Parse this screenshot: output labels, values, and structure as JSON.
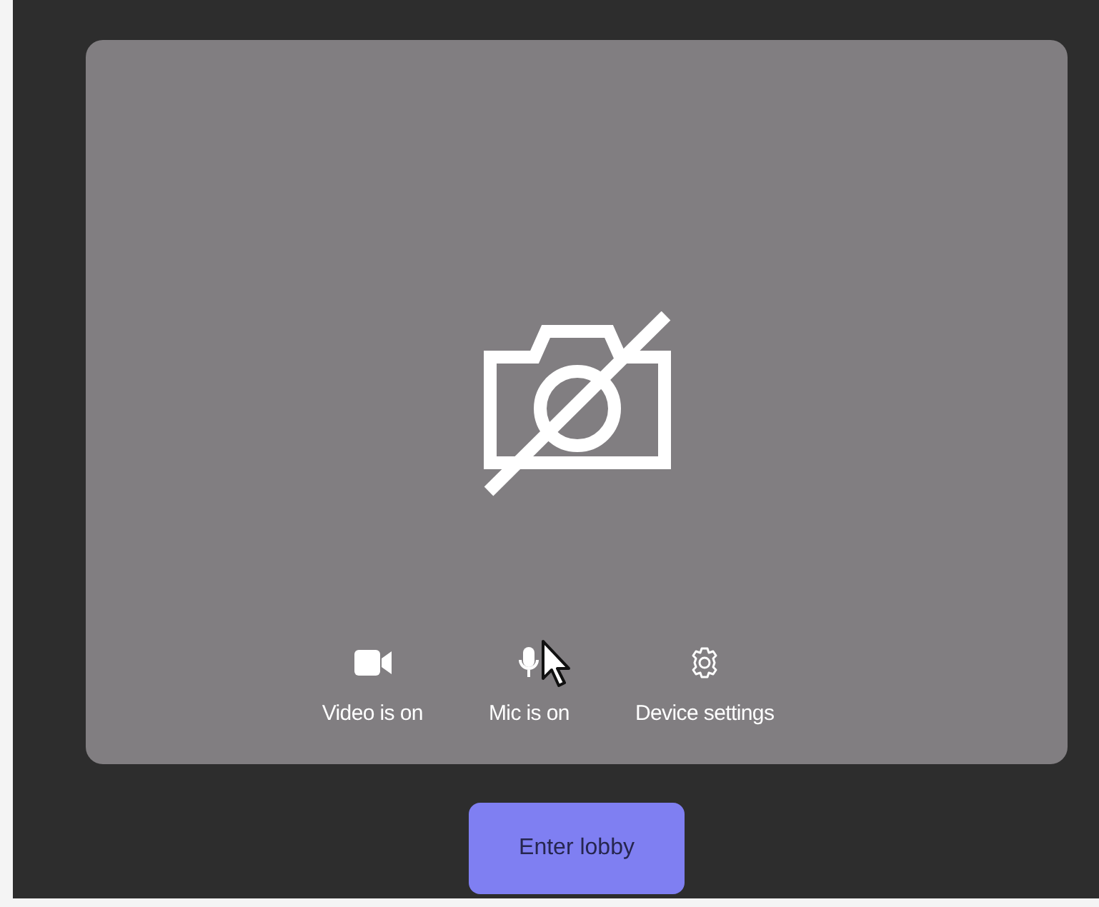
{
  "controls": [
    {
      "kind": "video",
      "label": "Video is on"
    },
    {
      "kind": "mic",
      "label": "Mic is on"
    },
    {
      "kind": "settings",
      "label": "Device settings"
    }
  ],
  "button": {
    "label": "Enter lobby"
  }
}
